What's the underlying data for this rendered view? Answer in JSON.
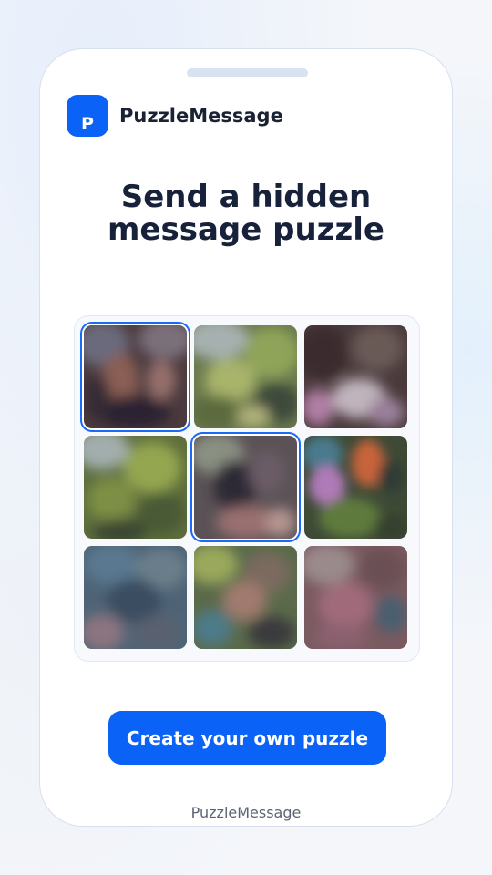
{
  "app": {
    "name": "PuzzleMessage",
    "logo_letter": "P",
    "brand_color": "#0a63f6"
  },
  "headline": {
    "line1": "Send a hidden",
    "line2": "message puzzle"
  },
  "puzzle": {
    "rows": 3,
    "cols": 3,
    "selected_tiles": [
      0,
      4
    ],
    "tiles": [
      {
        "index": 0,
        "selected": true
      },
      {
        "index": 1,
        "selected": false
      },
      {
        "index": 2,
        "selected": false
      },
      {
        "index": 3,
        "selected": false
      },
      {
        "index": 4,
        "selected": true
      },
      {
        "index": 5,
        "selected": false
      },
      {
        "index": 6,
        "selected": false
      },
      {
        "index": 7,
        "selected": false
      },
      {
        "index": 8,
        "selected": false
      }
    ]
  },
  "cta": {
    "label": "Create your own puzzle"
  },
  "footer": {
    "text": "PuzzleMessage"
  }
}
